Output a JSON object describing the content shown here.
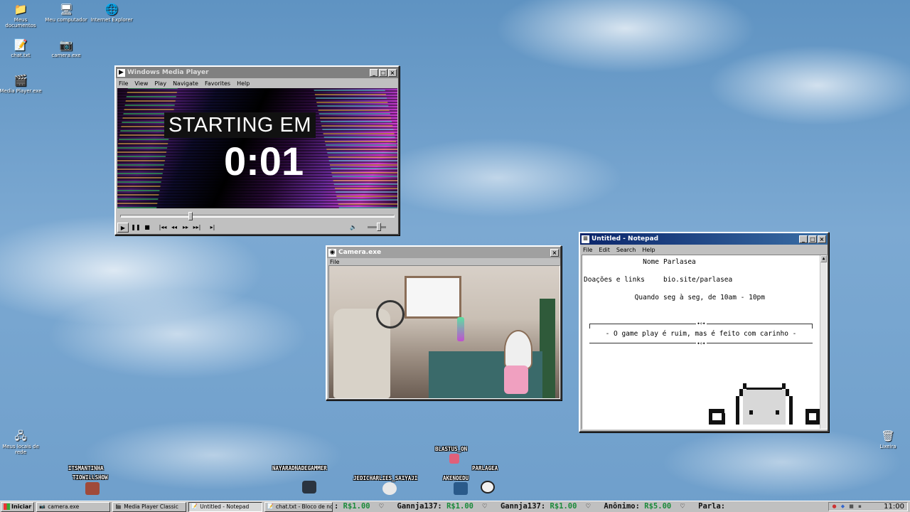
{
  "desktop": {
    "icons": [
      {
        "label": "Meus documentos",
        "glyph": "📁"
      },
      {
        "label": "Meu computador",
        "glyph": "🖥"
      },
      {
        "label": "Internet Explorer",
        "glyph": "🌐"
      },
      {
        "label": "chat.txt",
        "glyph": "📝"
      },
      {
        "label": "camera.exe",
        "glyph": "📷"
      },
      {
        "label": "Media Player.exe",
        "glyph": "🎬"
      },
      {
        "label": "Meus locais de rede",
        "glyph": "🖧"
      },
      {
        "label": "Lixeira",
        "glyph": "🗑"
      }
    ]
  },
  "media_player": {
    "title": "Windows Media Player",
    "menu": [
      "File",
      "View",
      "Play",
      "Navigate",
      "Favorites",
      "Help"
    ],
    "overlay_text": "STARTING EM",
    "countdown": "0:01",
    "seek_progress": 0.25,
    "volume_level": 0.65,
    "controls": {
      "play": "▶",
      "pause": "❚❚",
      "stop": "■",
      "prev": "|◂◂",
      "rewind": "◂◂",
      "forward": "▸▸",
      "next": "▸▸|",
      "preview": "▸|",
      "mute": "🔈"
    }
  },
  "camera": {
    "title": "Camera.exe",
    "menu": [
      "File"
    ]
  },
  "notepad": {
    "title": "Untitled - Notepad",
    "menu": [
      "File",
      "Edit",
      "Search",
      "Help"
    ],
    "fields": [
      {
        "label": "Nome",
        "value": "Parlasea"
      },
      {
        "label": "Doações e links",
        "value": "bio.site/parlasea"
      },
      {
        "label": "Quando",
        "value": "seg à seg, de 10am - 10pm"
      }
    ],
    "ornament": "⬩✧⬩",
    "motto": "- O game play é ruim, mas é feito com carinho -"
  },
  "chat_users": [
    {
      "name": "ITSMANTINHA"
    },
    {
      "name": "TIOWILLSHOW"
    },
    {
      "name": "NAYARADNADEGAMMER"
    },
    {
      "name": "BLASTUS_ON"
    },
    {
      "name": "JEDICHARLIES_SAIYAJI"
    },
    {
      "name": "AKENOEDU"
    },
    {
      "name": "PARLAGEA"
    }
  ],
  "taskbar": {
    "start_label": "Iniciar",
    "buttons": [
      {
        "label": "camera.exe",
        "icon": "📷"
      },
      {
        "label": "Media Player Classic",
        "icon": "🎬"
      },
      {
        "label": "Untitled - Notepad",
        "icon": "📝"
      },
      {
        "label": "chat.txt - Bloco de notas",
        "icon": "📝"
      }
    ],
    "ticker": [
      {
        "prefix": ": ",
        "amount": "R$1.00",
        "sep": "  ♡  "
      },
      {
        "prefix": "Gannja137: ",
        "amount": "R$1.00",
        "sep": "  ♡  "
      },
      {
        "prefix": "Gannja137: ",
        "amount": "R$1.00",
        "sep": "  ♡  "
      },
      {
        "prefix": "Anônimo: ",
        "amount": "R$5.00",
        "sep": "  ♡  "
      },
      {
        "prefix": "Parla:",
        "amount": "",
        "sep": ""
      }
    ],
    "clock": "11:00"
  },
  "colors": {
    "title_active": "#0a246a",
    "ticker_amount": "#1a8a3a",
    "sky": "#6f9fcb"
  }
}
